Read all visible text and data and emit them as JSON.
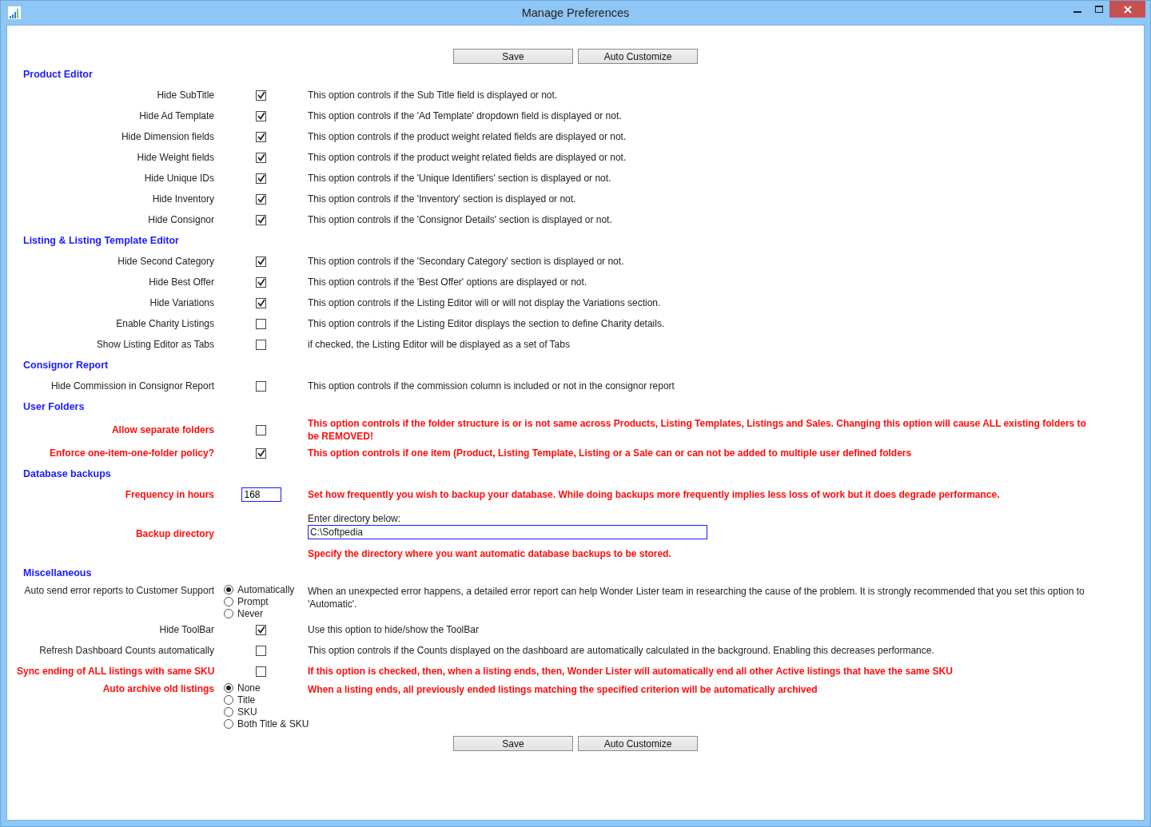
{
  "window": {
    "title": "Manage Preferences"
  },
  "top_buttons": [
    "Save",
    "Auto Customize"
  ],
  "sections": [
    {
      "title": "Product Editor",
      "rows": [
        {
          "kind": "checkbox",
          "label": "Hide SubTitle",
          "checked": true,
          "warning": false,
          "description": "This option controls if the Sub Title field is displayed or not."
        },
        {
          "kind": "checkbox",
          "label": "Hide Ad Template",
          "checked": true,
          "warning": false,
          "description": "This option controls if the 'Ad Template' dropdown field is displayed or not."
        },
        {
          "kind": "checkbox",
          "label": "Hide Dimension fields",
          "checked": true,
          "warning": false,
          "description": "This option controls if the product weight related fields are displayed or not."
        },
        {
          "kind": "checkbox",
          "label": "Hide Weight fields",
          "checked": true,
          "warning": false,
          "description": "This option controls if the product weight related fields are displayed or not."
        },
        {
          "kind": "checkbox",
          "label": "Hide Unique IDs",
          "checked": true,
          "warning": false,
          "description": "This option controls if the 'Unique Identifiers' section is displayed or not."
        },
        {
          "kind": "checkbox",
          "label": "Hide Inventory",
          "checked": true,
          "warning": false,
          "description": "This option controls if the 'Inventory' section is displayed or not."
        },
        {
          "kind": "checkbox",
          "label": "Hide Consignor",
          "checked": true,
          "warning": false,
          "description": "This option controls if the 'Consignor Details' section is displayed or not."
        }
      ]
    },
    {
      "title": "Listing & Listing Template Editor",
      "rows": [
        {
          "kind": "checkbox",
          "label": "Hide Second Category",
          "checked": true,
          "warning": false,
          "description": "This option controls if the 'Secondary Category' section is displayed or not."
        },
        {
          "kind": "checkbox",
          "label": "Hide Best Offer",
          "checked": true,
          "warning": false,
          "description": "This option controls if the 'Best Offer' options are displayed or not."
        },
        {
          "kind": "checkbox",
          "label": "Hide Variations",
          "checked": true,
          "warning": false,
          "description": "This option controls if the Listing Editor will or will not display the Variations section."
        },
        {
          "kind": "checkbox",
          "label": "Enable Charity Listings",
          "checked": false,
          "warning": false,
          "description": "This option controls if the Listing Editor displays the section to define Charity details."
        },
        {
          "kind": "checkbox",
          "label": "Show Listing Editor as Tabs",
          "checked": false,
          "warning": false,
          "description": "if checked, the Listing Editor will be displayed as a set of Tabs"
        }
      ]
    },
    {
      "title": "Consignor Report",
      "rows": [
        {
          "kind": "checkbox",
          "label": "Hide Commission in Consignor Report",
          "checked": false,
          "warning": false,
          "description": "This option controls if the commission column is included or not in the consignor report"
        }
      ]
    },
    {
      "title": "User Folders",
      "rows": [
        {
          "kind": "checkbox",
          "label": "Allow separate folders",
          "checked": false,
          "warning": true,
          "description": "This option controls if the folder structure is or is not same across Products, Listing Templates, Listings and Sales. Changing this option will cause ALL existing folders to be REMOVED!"
        },
        {
          "kind": "checkbox",
          "label": "Enforce one-item-one-folder policy?",
          "checked": true,
          "warning": true,
          "description": "This option controls if one item (Product, Listing Template, Listing or a Sale can or can not be added to multiple user defined folders"
        }
      ]
    },
    {
      "title": "Database backups",
      "rows": [
        {
          "kind": "number",
          "label": "Frequency in hours",
          "value": "168",
          "warning": true,
          "description": "Set how frequently you wish to backup your database. While doing backups more frequently implies less loss of work but it does degrade performance."
        },
        {
          "kind": "directory",
          "label": "Backup directory",
          "caption": "Enter directory below:",
          "value": "C:\\Softpedia",
          "warning": true,
          "description": "Specify the directory where you want automatic database backups to be stored."
        }
      ]
    },
    {
      "title": "Miscellaneous",
      "rows": [
        {
          "kind": "radio",
          "label": "Auto send error reports to Customer Support",
          "warning": false,
          "options": [
            {
              "label": "Automatically",
              "selected": true
            },
            {
              "label": "Prompt",
              "selected": false
            },
            {
              "label": "Never",
              "selected": false
            }
          ],
          "description": "When an unexpected error happens, a detailed error report can help Wonder Lister team in researching the cause of the problem. It is strongly recommended that you set this option to 'Automatic'."
        },
        {
          "kind": "checkbox",
          "label": "Hide ToolBar",
          "checked": true,
          "warning": false,
          "description": "Use this option to hide/show the ToolBar"
        },
        {
          "kind": "checkbox",
          "label": "Refresh Dashboard Counts automatically",
          "checked": false,
          "warning": false,
          "description": "This option controls if the Counts displayed on the dashboard are automatically calculated in the background. Enabling this decreases performance."
        },
        {
          "kind": "checkbox",
          "label": "Sync ending of ALL listings with same SKU",
          "checked": false,
          "warning": true,
          "description": "If this option is checked, then, when a listing ends, then, Wonder Lister will automatically end all other Active listings that have the same SKU"
        },
        {
          "kind": "radio",
          "label": "Auto archive old listings",
          "warning": true,
          "options": [
            {
              "label": "None",
              "selected": true
            },
            {
              "label": "Title",
              "selected": false
            },
            {
              "label": "SKU",
              "selected": false
            },
            {
              "label": "Both Title & SKU",
              "selected": false
            }
          ],
          "description": "When a listing ends, all previously ended listings matching the specified criterion will be automatically archived"
        }
      ]
    }
  ],
  "bottom_buttons": [
    "Save",
    "Auto Customize"
  ]
}
